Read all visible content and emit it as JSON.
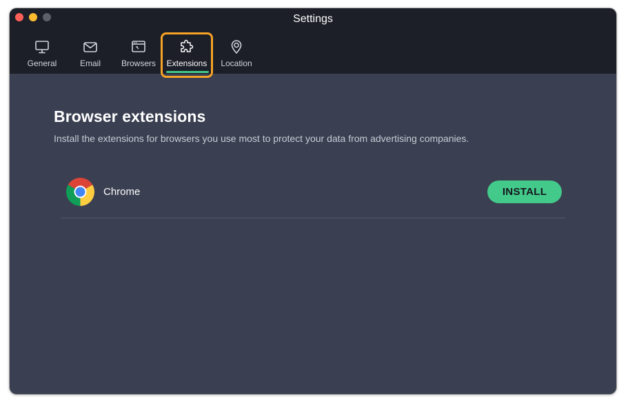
{
  "window": {
    "title": "Settings"
  },
  "tabs": [
    {
      "label": "General",
      "icon": "monitor-icon"
    },
    {
      "label": "Email",
      "icon": "envelope-icon"
    },
    {
      "label": "Browsers",
      "icon": "browser-window-icon"
    },
    {
      "label": "Extensions",
      "icon": "puzzle-icon",
      "active": true
    },
    {
      "label": "Location",
      "icon": "location-pin-icon"
    }
  ],
  "content": {
    "title": "Browser extensions",
    "subtitle": "Install the extensions for browsers you use most to protect your data from advertising companies."
  },
  "extensions": [
    {
      "name": "Chrome",
      "icon": "chrome-logo-icon",
      "action_label": "INSTALL"
    }
  ],
  "colors": {
    "accent": "#43c98a",
    "highlight": "#f7a325",
    "header_bg": "#1c1f28",
    "content_bg": "#3a3f51"
  }
}
